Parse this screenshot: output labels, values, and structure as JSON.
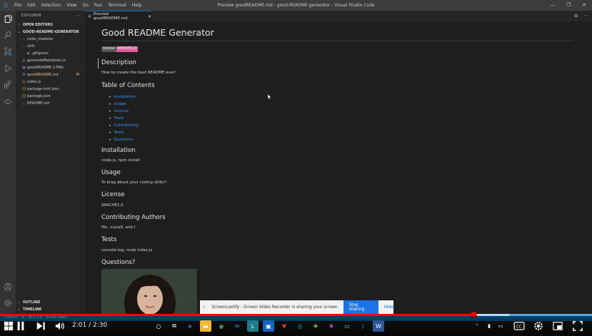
{
  "titlebar": {
    "menu": [
      "File",
      "Edit",
      "Selection",
      "View",
      "Go",
      "Run",
      "Terminal",
      "Help"
    ],
    "title": "Preview goodREADME.md - good-README-generator - Visual Studio Code",
    "controls": [
      "—",
      "❐",
      "✕"
    ]
  },
  "sidebar": {
    "header": "EXPLORER",
    "header_more": "···",
    "open_editors": "OPEN EDITORS",
    "project": "GOOD-README-GENERATOR",
    "items": [
      {
        "label": "node_modules",
        "icon": "›",
        "indent": 1
      },
      {
        "label": "utils",
        "icon": "⌄",
        "indent": 1
      },
      {
        "label": ".gitignore",
        "icon": "◆",
        "indent": 2
      },
      {
        "label": "generateMarkdown.js",
        "icon": "JS",
        "indent": 1
      },
      {
        "label": "goodREADME-1.PNG",
        "icon": "▣",
        "indent": 1
      },
      {
        "label": "goodREADME.md",
        "icon": "M",
        "indent": 1,
        "modified": "M"
      },
      {
        "label": "index.js",
        "icon": "JS",
        "indent": 1
      },
      {
        "label": "package-lock.json",
        "icon": "{}",
        "indent": 1
      },
      {
        "label": "package.json",
        "icon": "{}",
        "indent": 1
      },
      {
        "label": "README.md",
        "icon": "ⓘ",
        "indent": 1
      }
    ],
    "outline": "OUTLINE",
    "timeline": "TIMELINE"
  },
  "tab": {
    "label": "Preview goodREADME.md",
    "close": "✕",
    "actions": [
      "⊞",
      "···"
    ]
  },
  "preview": {
    "title": "Good README Generator",
    "badge_left": "license",
    "badge_right": "APACHE2.0",
    "sections": {
      "description_h": "Description",
      "description": "How to create the best README ever!",
      "toc_h": "Table of Contents",
      "toc": [
        "Installation",
        "Usage",
        "License",
        "Tests",
        "Contributing",
        "Tests",
        "Questions"
      ],
      "installation_h": "Installation",
      "installation": "node.js, npm install",
      "usage_h": "Usage",
      "usage": "To brag about your coding skills!!",
      "license_h": "License",
      "license": "APACHE2.0",
      "contrib_h": "Contributing Authors",
      "contrib": "Me, myself, and I",
      "tests_h": "Tests",
      "tests": "console.log, node index.js",
      "questions_h": "Questions?"
    }
  },
  "notification": {
    "grip": "⁞⁞",
    "message": "Screencastify - Screen Video Recorder is sharing your screen.",
    "stop": "Stop sharing",
    "hide": "Hide"
  },
  "statusbar": {
    "branch": "master*",
    "sync": "⟳",
    "problems": "⊗ 0 ⚠ 0",
    "liveshare": "⇄ Live Share"
  },
  "video": {
    "time": "2:01 / 2:30",
    "progress": 0.8,
    "buffered": 0.86
  },
  "colors": {
    "accent": "#007acc",
    "link": "#3794ff",
    "badge": "#e05d9b",
    "youtube_red": "#ff0000"
  }
}
